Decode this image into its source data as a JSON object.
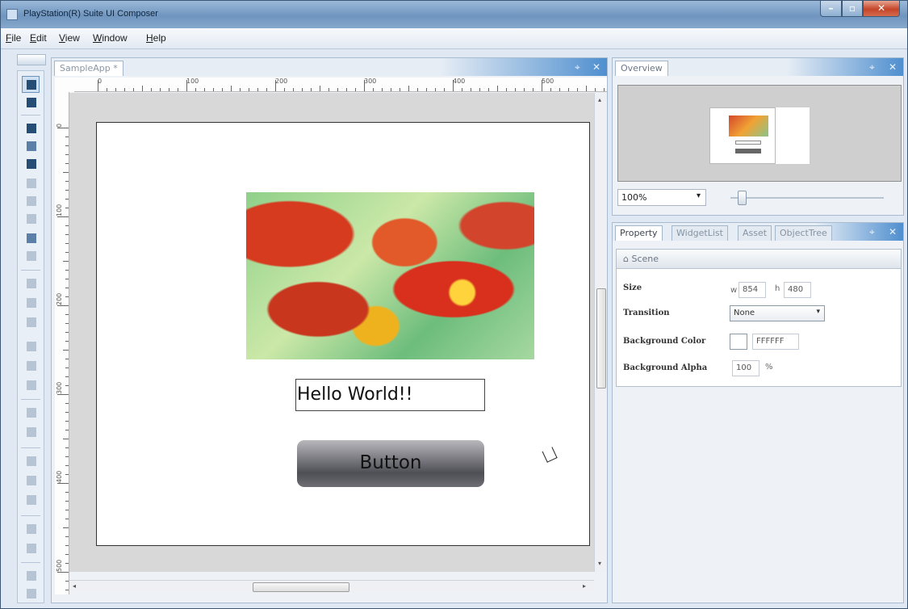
{
  "window": {
    "title": "PlayStation(R) Suite UI Composer",
    "min_glyph": "–",
    "max_glyph": "▫",
    "close_glyph": "✕"
  },
  "menu": [
    "File",
    "Edit",
    "View",
    "Window",
    "Help"
  ],
  "document": {
    "tab_label": "SampleApp *",
    "ruler_h_labels": [
      "0",
      "100",
      "200",
      "300",
      "400",
      "500"
    ],
    "ruler_v_labels": [
      "0",
      "100",
      "200",
      "300",
      "400",
      "500"
    ],
    "scene": {
      "text_label": "Hello World!!",
      "button_label": "Button"
    }
  },
  "overview": {
    "tab_label": "Overview",
    "zoom": "100%",
    "zoom_slider_level_percent": 5
  },
  "property": {
    "tabs": [
      "Property",
      "WidgetList",
      "Asset",
      "ObjectTree"
    ],
    "section": "Scene",
    "section_glyph": "⌂",
    "size_label": "Size",
    "width_prefix": "w",
    "width": "854",
    "height_prefix": "h",
    "height": "480",
    "transition_label": "Transition",
    "transition_value": "None",
    "bg_color_label": "Background Color",
    "bg_color_value": "FFFFFF",
    "bg_alpha_label": "Background Alpha",
    "bg_alpha_value": "100",
    "bg_alpha_unit": "%"
  },
  "colors": {
    "title_bar": "#7ea3c9",
    "close_button": "#c5452a",
    "scene_button": "#6e6e74",
    "accent_tab": "#4f8fcf"
  },
  "icons": {
    "dropdown": "▾",
    "pane_pin": "⌖",
    "pane_close": "✕",
    "scroll_left": "◂",
    "scroll_right": "▸",
    "scroll_up": "▴",
    "scroll_down": "▾"
  }
}
